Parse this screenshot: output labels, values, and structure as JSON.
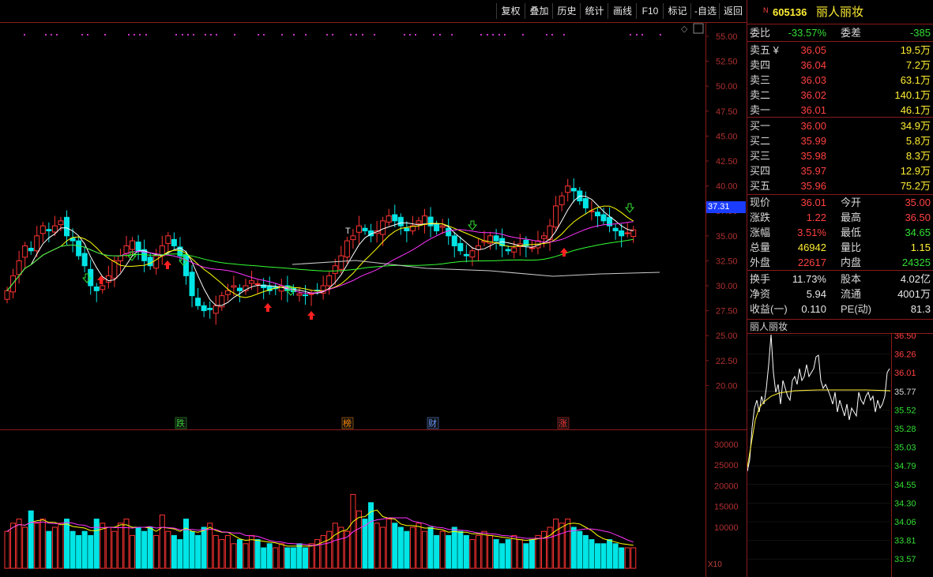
{
  "toolbar": {
    "buttons": [
      "复权",
      "叠加",
      "历史",
      "统计",
      "画线",
      "F10",
      "标记",
      "-自选",
      "返回"
    ]
  },
  "kline": {
    "price_axis": [
      "55.00",
      "52.50",
      "50.00",
      "47.50",
      "45.00",
      "42.50",
      "40.00",
      "37.50",
      "35.00",
      "32.50",
      "30.00",
      "27.50",
      "25.00",
      "22.50",
      "20.00"
    ],
    "current_tag": "37.31",
    "events": [
      {
        "text": "跌",
        "color": "#33cc33"
      },
      {
        "text": "榜",
        "color": "#ff8800"
      },
      {
        "text": "财",
        "color": "#6699ff"
      },
      {
        "text": "涨",
        "color": "#ff3333"
      }
    ],
    "t_marker": "T"
  },
  "volume": {
    "axis": [
      "30000",
      "25000",
      "20000",
      "15000",
      "10000"
    ],
    "unit": "X10"
  },
  "stock": {
    "badge": "N",
    "code": "605136",
    "name": "丽人丽妆"
  },
  "quote": {
    "weibi_label": "委比",
    "weibi": "-33.57%",
    "weicha_label": "委差",
    "weicha": "-385",
    "sell": [
      {
        "label": "卖五 ¥",
        "price": "36.05",
        "vol": "19.5万"
      },
      {
        "label": "卖四",
        "price": "36.04",
        "vol": "7.2万"
      },
      {
        "label": "卖三",
        "price": "36.03",
        "vol": "63.1万"
      },
      {
        "label": "卖二",
        "price": "36.02",
        "vol": "140.1万"
      },
      {
        "label": "卖一",
        "price": "36.01",
        "vol": "46.1万"
      }
    ],
    "buy": [
      {
        "label": "买一",
        "price": "36.00",
        "vol": "34.9万"
      },
      {
        "label": "买二",
        "price": "35.99",
        "vol": "5.8万"
      },
      {
        "label": "买三",
        "price": "35.98",
        "vol": "8.3万"
      },
      {
        "label": "买四",
        "price": "35.97",
        "vol": "12.9万"
      },
      {
        "label": "买五",
        "price": "35.96",
        "vol": "75.2万"
      }
    ],
    "stats": [
      {
        "l1": "现价",
        "v1": "36.01",
        "c1": "red",
        "l2": "今开",
        "v2": "35.00",
        "c2": "red"
      },
      {
        "l1": "涨跌",
        "v1": "1.22",
        "c1": "red",
        "l2": "最高",
        "v2": "36.50",
        "c2": "red"
      },
      {
        "l1": "涨幅",
        "v1": "3.51%",
        "c1": "red",
        "l2": "最低",
        "v2": "34.65",
        "c2": "grn"
      },
      {
        "l1": "总量",
        "v1": "46942",
        "c1": "yel",
        "l2": "量比",
        "v2": "1.15",
        "c2": "yel"
      },
      {
        "l1": "外盘",
        "v1": "22617",
        "c1": "red",
        "l2": "内盘",
        "v2": "24325",
        "c2": "grn"
      }
    ],
    "stats2": [
      {
        "l1": "换手",
        "v1": "11.73%",
        "l2": "股本",
        "v2": "4.02亿"
      },
      {
        "l1": "净资",
        "v1": "5.94",
        "l2": "流通",
        "v2": "4001万"
      },
      {
        "l1": "收益(一)",
        "v1": "0.110",
        "l2": "PE(动)",
        "v2": "81.3"
      }
    ]
  },
  "intraday": {
    "title": "丽人丽妆",
    "axis": [
      "36.50",
      "36.26",
      "36.01",
      "35.77",
      "35.52",
      "35.28",
      "35.03",
      "34.79",
      "34.55",
      "34.30",
      "34.06",
      "33.81",
      "33.57"
    ]
  }
}
